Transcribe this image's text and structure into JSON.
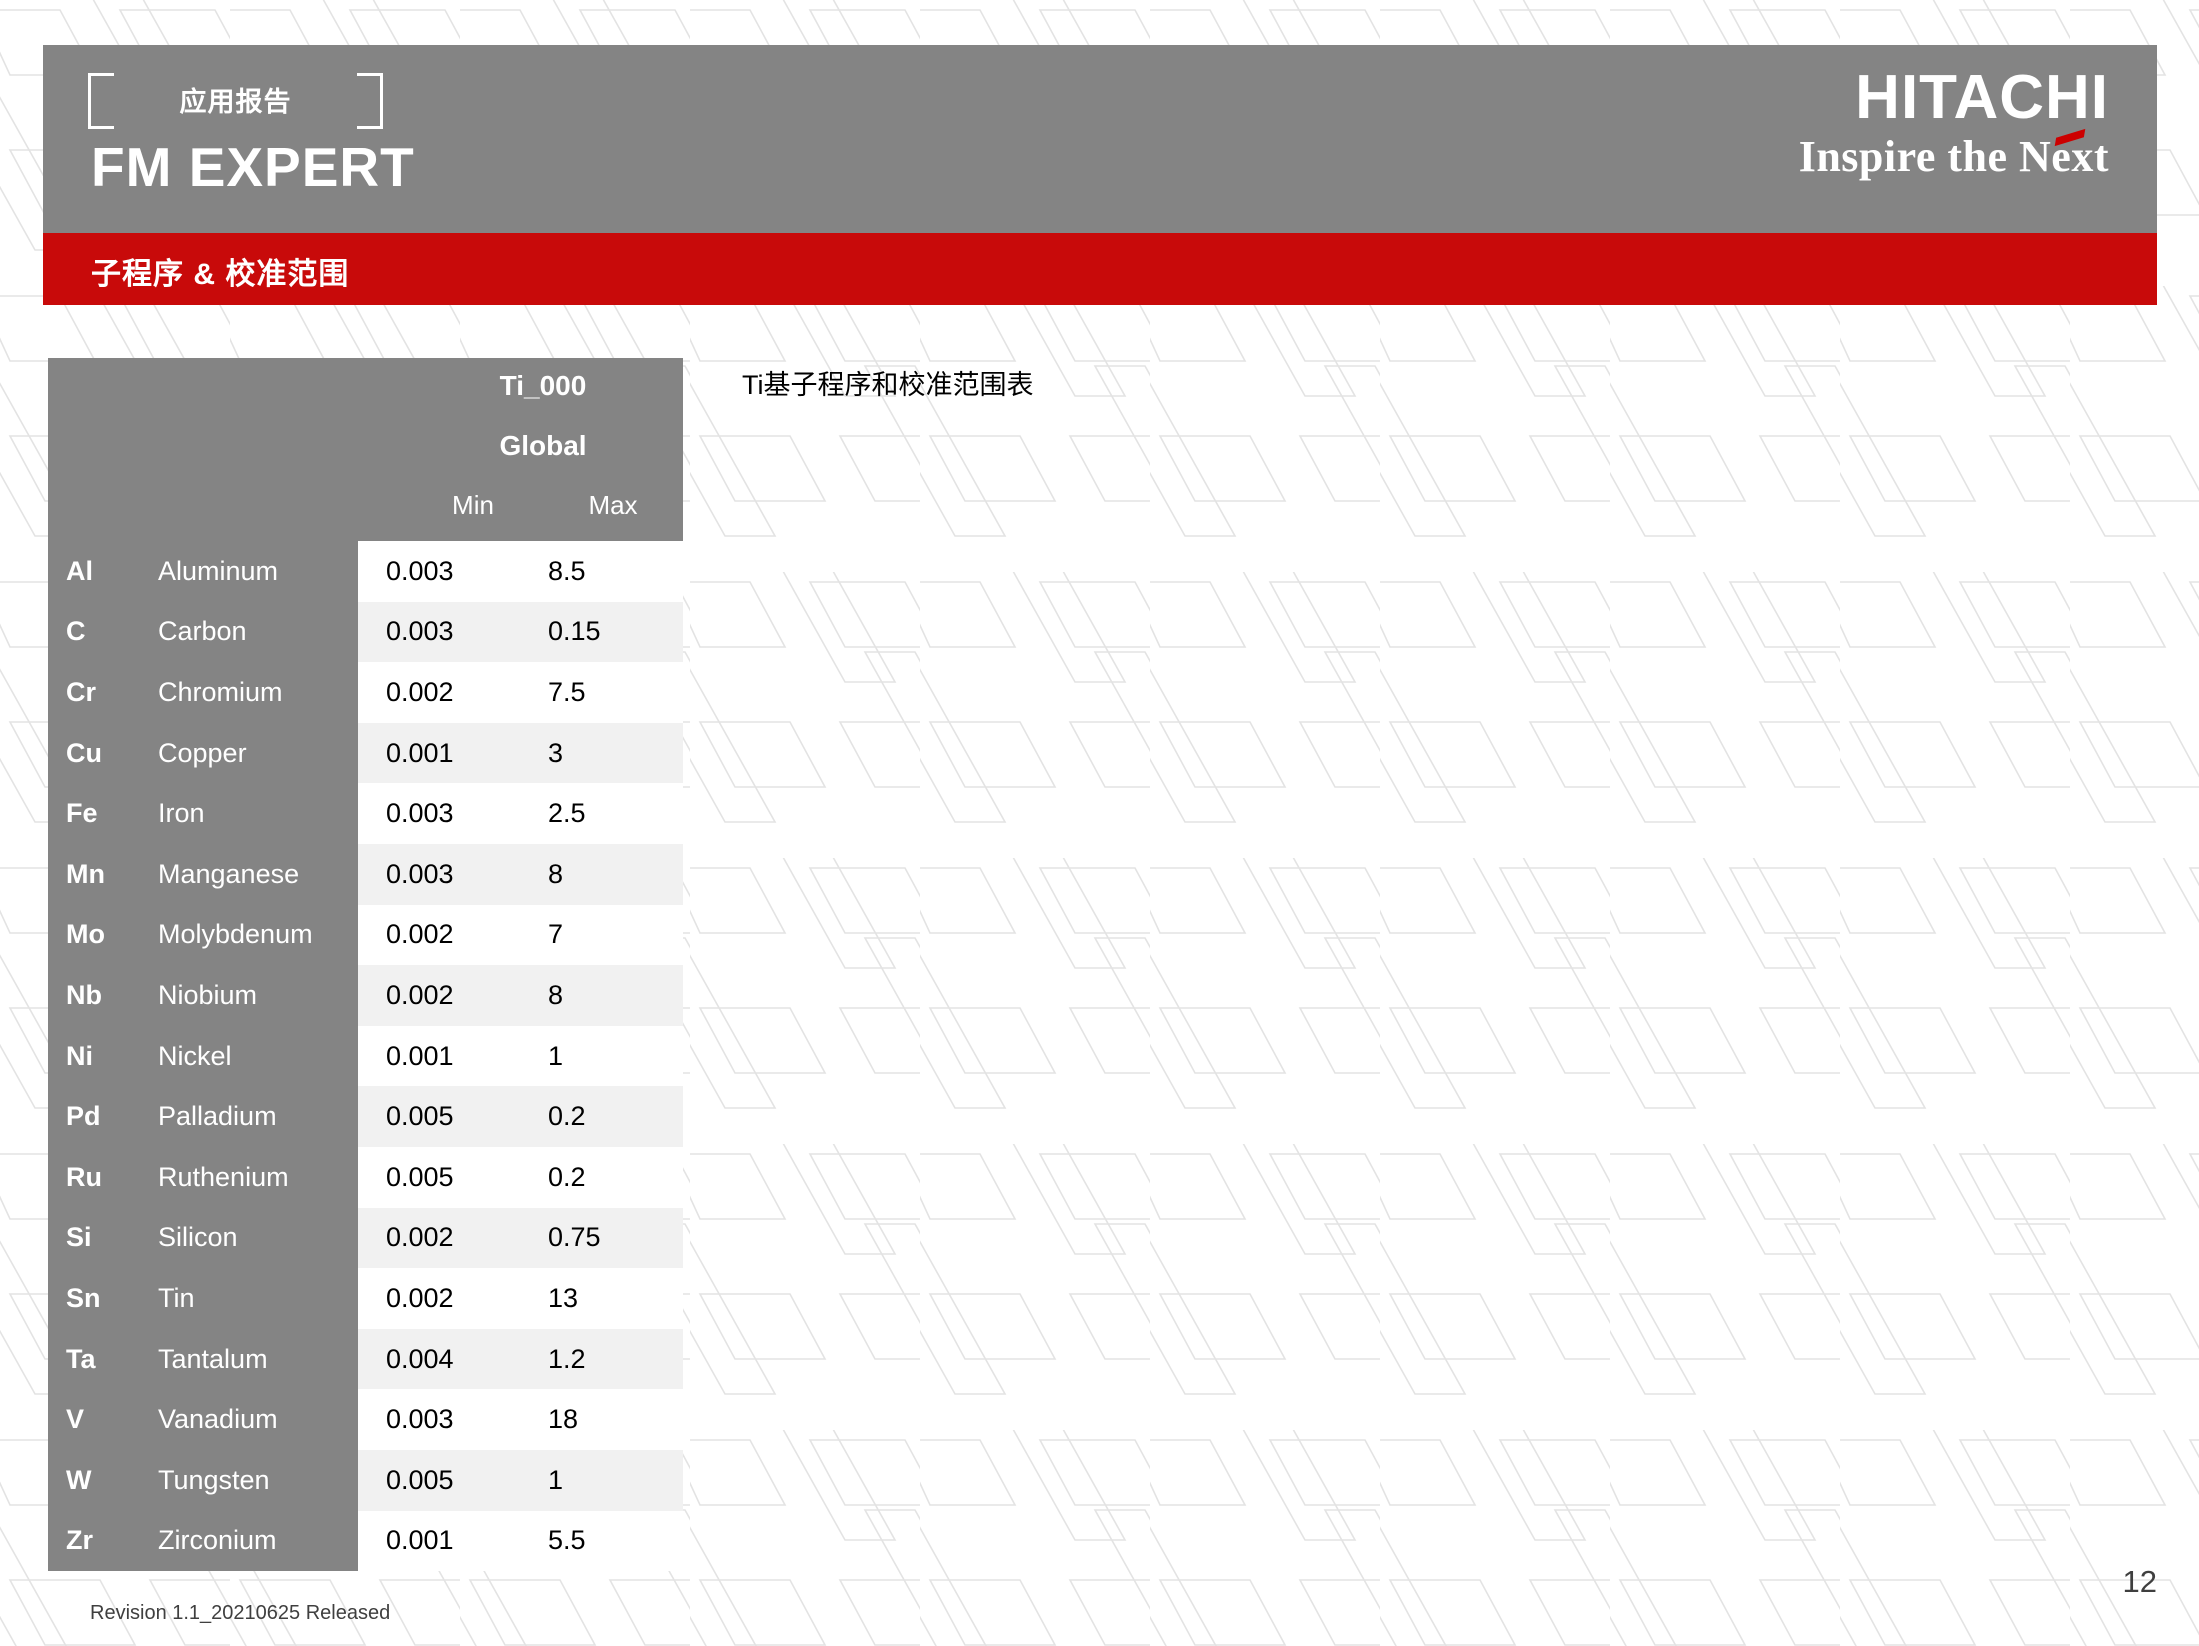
{
  "header": {
    "report_kind": "应用报告",
    "brand_title": "FM EXPERT",
    "logo_wordmark": "HITACHI",
    "logo_tagline": "Inspire the Next",
    "subtitle": "子程序 & 校准范围",
    "banner_color": "#848484",
    "subtitle_bar_color": "#c80a0a",
    "accent_color": "#cc0000"
  },
  "caption": "Ti基子程序和校准范围表",
  "table": {
    "program_name": "Ti_000",
    "scope_label": "Global",
    "min_label": "Min",
    "max_label": "Max",
    "rows": [
      {
        "symbol": "Al",
        "name": "Aluminum",
        "min": "0.003",
        "max": "8.5"
      },
      {
        "symbol": "C",
        "name": "Carbon",
        "min": "0.003",
        "max": "0.15"
      },
      {
        "symbol": "Cr",
        "name": "Chromium",
        "min": "0.002",
        "max": "7.5"
      },
      {
        "symbol": "Cu",
        "name": "Copper",
        "min": "0.001",
        "max": "3"
      },
      {
        "symbol": "Fe",
        "name": "Iron",
        "min": "0.003",
        "max": "2.5"
      },
      {
        "symbol": "Mn",
        "name": "Manganese",
        "min": "0.003",
        "max": "8"
      },
      {
        "symbol": "Mo",
        "name": "Molybdenum",
        "min": "0.002",
        "max": "7"
      },
      {
        "symbol": "Nb",
        "name": "Niobium",
        "min": "0.002",
        "max": "8"
      },
      {
        "symbol": "Ni",
        "name": "Nickel",
        "min": "0.001",
        "max": "1"
      },
      {
        "symbol": "Pd",
        "name": "Palladium",
        "min": "0.005",
        "max": "0.2"
      },
      {
        "symbol": "Ru",
        "name": "Ruthenium",
        "min": "0.005",
        "max": "0.2"
      },
      {
        "symbol": "Si",
        "name": "Silicon",
        "min": "0.002",
        "max": "0.75"
      },
      {
        "symbol": "Sn",
        "name": "Tin",
        "min": "0.002",
        "max": "13"
      },
      {
        "symbol": "Ta",
        "name": "Tantalum",
        "min": "0.004",
        "max": "1.2"
      },
      {
        "symbol": "V",
        "name": "Vanadium",
        "min": "0.003",
        "max": "18"
      },
      {
        "symbol": "W",
        "name": "Tungsten",
        "min": "0.005",
        "max": "1"
      },
      {
        "symbol": "Zr",
        "name": "Zirconium",
        "min": "0.001",
        "max": "5.5"
      }
    ]
  },
  "footer": {
    "revision": "Revision 1.1_20210625 Released",
    "page_number": "12"
  }
}
